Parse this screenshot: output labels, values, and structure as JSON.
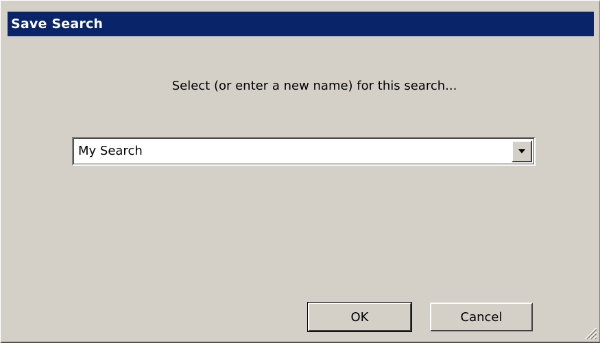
{
  "window": {
    "title": "Save Search"
  },
  "dialog": {
    "prompt": "Select (or enter a new name) for this search...",
    "combo": {
      "value": "My Search"
    },
    "ok_label": "OK",
    "cancel_label": "Cancel"
  },
  "icons": {
    "dropdown": "chevron-down-icon",
    "resize": "resize-grip-icon"
  },
  "colors": {
    "titlebar": "#0a246a",
    "face": "#d4d0c8"
  }
}
